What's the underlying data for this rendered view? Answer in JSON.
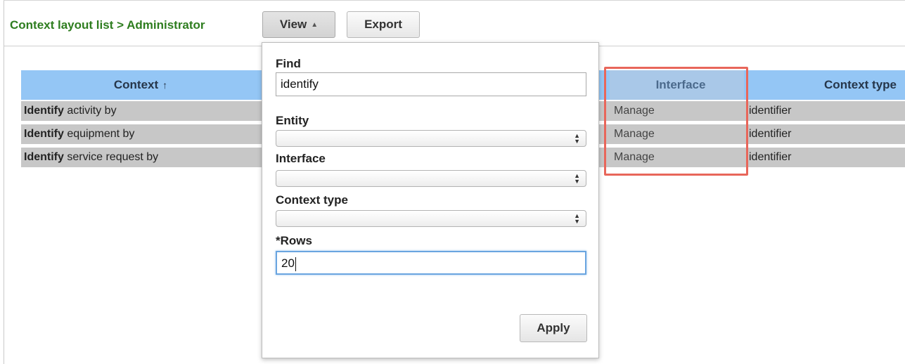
{
  "header": {
    "breadcrumb": "Context layout list > Administrator",
    "view_label": "View",
    "view_icon": "triangle-up-icon",
    "export_label": "Export"
  },
  "table": {
    "columns": {
      "context": "Context",
      "context_sort_icon": "↑",
      "interface": "Interface",
      "context_type": "Context type"
    },
    "rows": [
      {
        "context_bold": "Identify",
        "context_rest": " activity by",
        "interface": "Manage",
        "context_type": "identifier"
      },
      {
        "context_bold": "Identify",
        "context_rest": " equipment by",
        "interface": "Manage",
        "context_type": "identifier"
      },
      {
        "context_bold": "Identify",
        "context_rest": " service request by",
        "interface": "Manage",
        "context_type": "identifier"
      }
    ]
  },
  "filter_panel": {
    "find_label": "Find",
    "find_value": "identify",
    "entity_label": "Entity",
    "entity_value": "",
    "interface_label": "Interface",
    "interface_value": "",
    "context_type_label": "Context type",
    "context_type_value": "",
    "rows_label": "*Rows",
    "rows_value": "20",
    "apply_label": "Apply"
  },
  "colors": {
    "breadcrumb": "#2e7d1f",
    "table_header": "#94c6f5",
    "row_bg": "#c7c7c7",
    "highlight": "#e8665a",
    "focus": "#6aa5e0"
  }
}
